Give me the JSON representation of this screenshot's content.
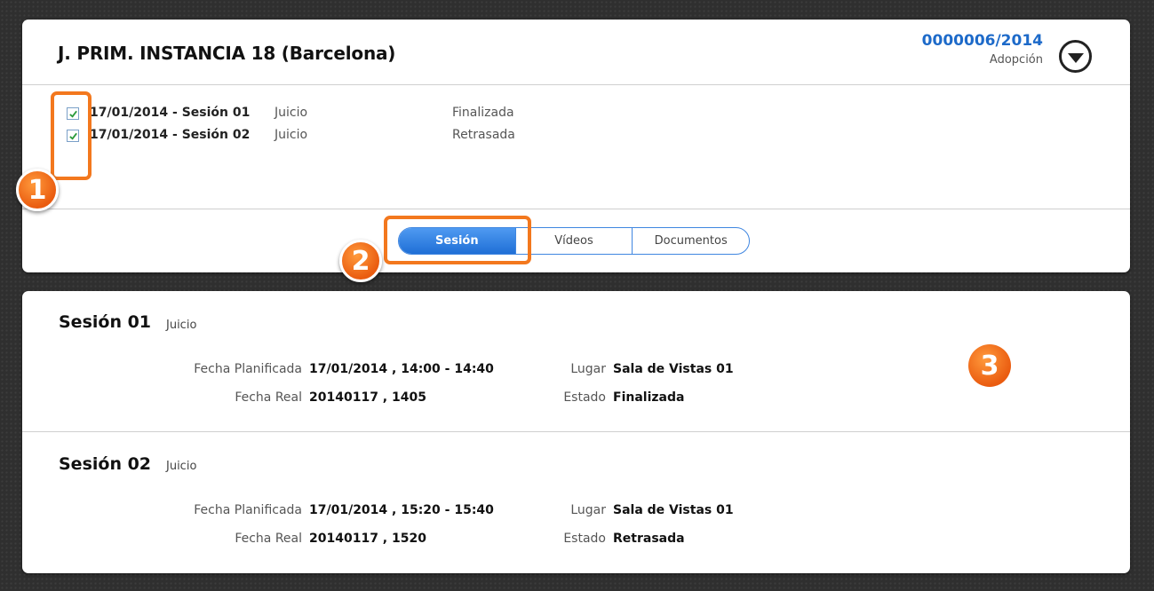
{
  "header": {
    "court": "J. PRIM. INSTANCIA 18 (Barcelona)",
    "case_number": "0000006/2014",
    "case_type": "Adopción"
  },
  "sessions_list": [
    {
      "checked": true,
      "name": "17/01/2014 - Sesión 01",
      "type": "Juicio",
      "state": "Finalizada"
    },
    {
      "checked": true,
      "name": "17/01/2014 - Sesión 02",
      "type": "Juicio",
      "state": "Retrasada"
    }
  ],
  "tabs": [
    {
      "label": "Sesión",
      "active": true
    },
    {
      "label": "Vídeos",
      "active": false
    },
    {
      "label": "Documentos",
      "active": false
    }
  ],
  "badges": [
    "1",
    "2",
    "3"
  ],
  "details": [
    {
      "title": "Sesión 01",
      "kind": "Juicio",
      "labels": {
        "planned": "Fecha Planificada",
        "real": "Fecha Real",
        "place": "Lugar",
        "state": "Estado"
      },
      "planned": "17/01/2014 , 14:00 - 14:40",
      "real": "20140117 , 1405",
      "place": "Sala de Vistas 01",
      "state": "Finalizada"
    },
    {
      "title": "Sesión 02",
      "kind": "Juicio",
      "labels": {
        "planned": "Fecha Planificada",
        "real": "Fecha Real",
        "place": "Lugar",
        "state": "Estado"
      },
      "planned": "17/01/2014 , 15:20 - 15:40",
      "real": "20140117 , 1520",
      "place": "Sala de Vistas 01",
      "state": "Retrasada"
    }
  ],
  "colors": {
    "accent_blue": "#1d6ac9",
    "tab_active": "#3f86e0",
    "annotation_orange": "#f3781e"
  }
}
